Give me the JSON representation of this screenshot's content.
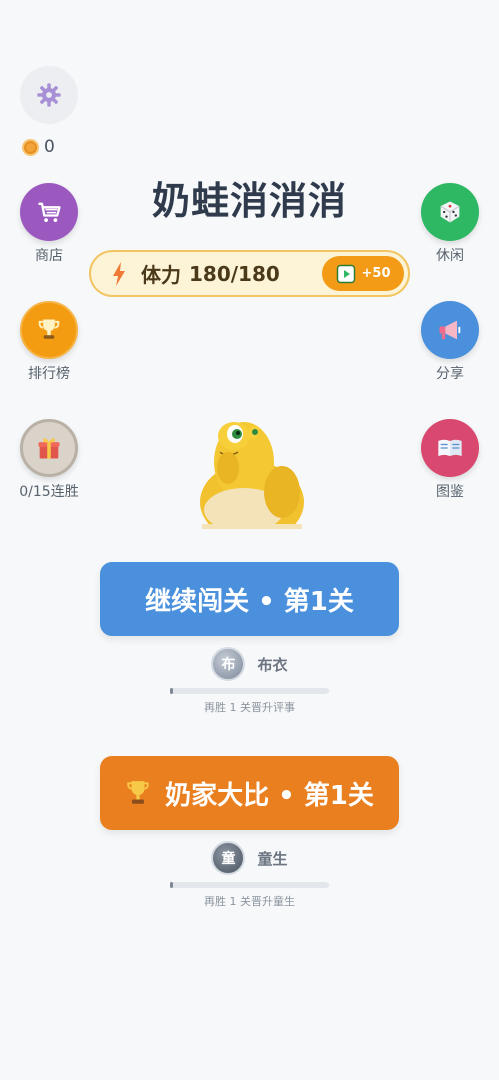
{
  "coins": "0",
  "title": "奶蛙消消消",
  "left_menu": {
    "shop": "商店",
    "leaderboard": "排行榜",
    "streak": "0/15连胜"
  },
  "right_menu": {
    "casual": "休闲",
    "share": "分享",
    "gallery": "图鉴"
  },
  "stamina": {
    "label": "体力",
    "value": "180/180",
    "ad_reward": "+50"
  },
  "continue_section": {
    "button_label": "继续闯关 • 第1关",
    "rank_badge": "布",
    "rank_name": "布衣",
    "progress": 0,
    "hint": "再胜 1 关晋升评事"
  },
  "pk_section": {
    "button_label": "奶家大比 • 第1关",
    "rank_badge": "童",
    "rank_name": "童生",
    "progress": 0,
    "hint": "再胜 1 关晋升童生"
  },
  "colors": {
    "shop": "#9b59c0",
    "leaderboard": "#f39c12",
    "streak": "#c9c2b8",
    "casual": "#2eb864",
    "share": "#4a90dc",
    "gallery": "#d9486e",
    "continue_button": "#4a90dc",
    "pk_button": "#ea7f20"
  },
  "icons": {
    "settings": "gear-icon",
    "shop": "cart-icon",
    "leaderboard": "trophy-icon",
    "streak": "gift-icon",
    "casual": "dice-icon",
    "share": "megaphone-icon",
    "gallery": "book-icon",
    "stamina": "lightning-icon",
    "ad": "video-play-icon",
    "pk": "trophy-icon"
  }
}
